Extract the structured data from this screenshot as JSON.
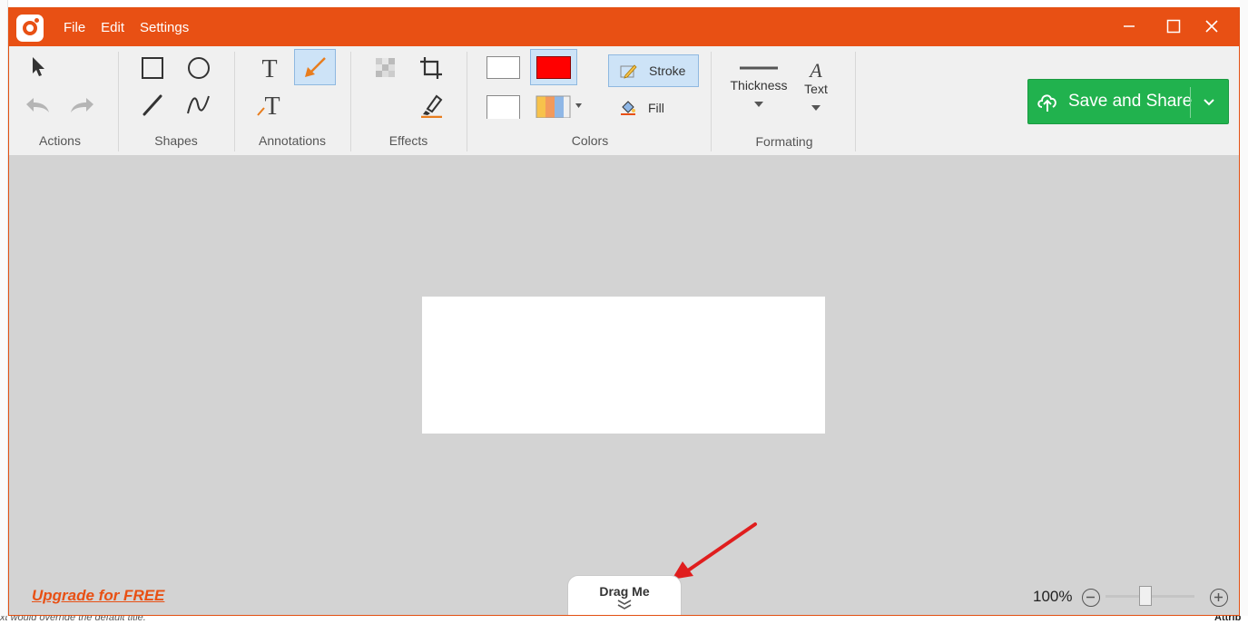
{
  "menu": {
    "file": "File",
    "edit": "Edit",
    "settings": "Settings"
  },
  "toolbar": {
    "groups": {
      "actions": "Actions",
      "shapes": "Shapes",
      "annotations": "Annotations",
      "effects": "Effects",
      "colors": "Colors",
      "formatting": "Formating"
    },
    "stroke_label": "Stroke",
    "fill_label": "Fill",
    "thickness_label": "Thickness",
    "text_label": "Text",
    "save_label": "Save and Share"
  },
  "colors": {
    "accent": "#e85014",
    "stroke_color": "#ff0000",
    "save_green": "#21b24e"
  },
  "footer": {
    "upgrade": "Upgrade for FREE",
    "drag": "Drag Me",
    "zoom": "100%"
  },
  "background": {
    "bottom_text": "xt would override the default title.",
    "right_text": "Attrib"
  }
}
